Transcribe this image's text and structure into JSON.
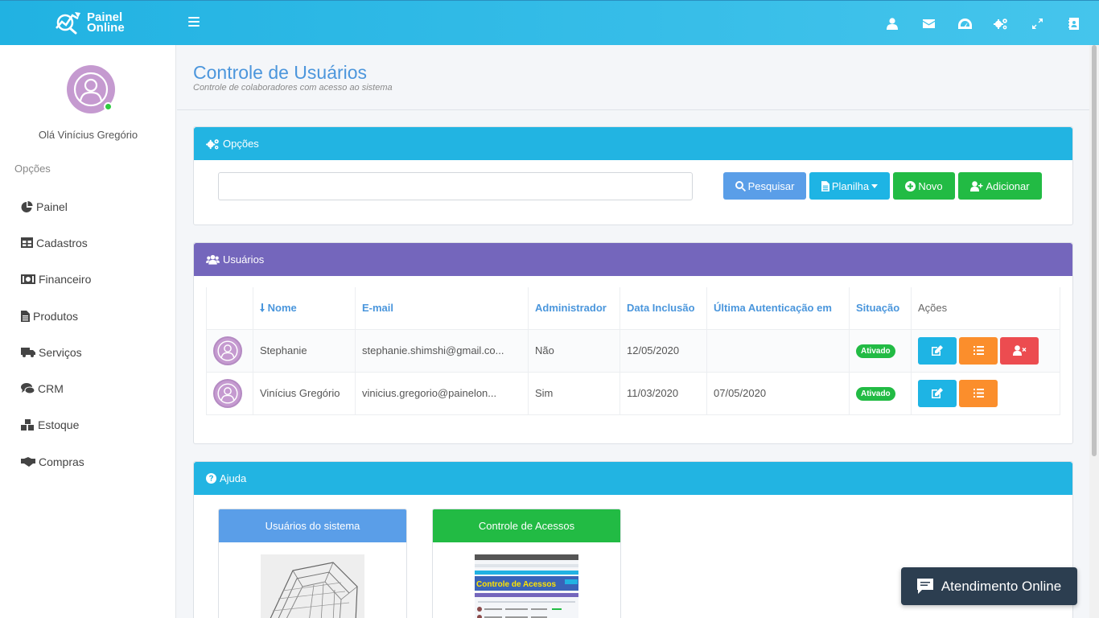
{
  "brand": {
    "line1": "Painel",
    "line2": "Online"
  },
  "topbar": {
    "icons": [
      "user-icon",
      "envelope-icon",
      "dashboard-icon",
      "cogs-icon",
      "expand-icon",
      "address-book-icon"
    ]
  },
  "sidebar": {
    "greeting": "Olá Vinícius Gregório",
    "section_title": "Opções",
    "items": [
      {
        "label": "Painel",
        "icon": "pie-chart-icon"
      },
      {
        "label": "Cadastros",
        "icon": "table-icon"
      },
      {
        "label": "Financeiro",
        "icon": "money-icon"
      },
      {
        "label": "Produtos",
        "icon": "file-icon"
      },
      {
        "label": "Serviços",
        "icon": "truck-icon"
      },
      {
        "label": "CRM",
        "icon": "comments-icon"
      },
      {
        "label": "Estoque",
        "icon": "cubes-icon"
      },
      {
        "label": "Compras",
        "icon": "handshake-icon"
      }
    ]
  },
  "page": {
    "title": "Controle de Usuários",
    "subtitle": "Controle de colaboradores com acesso ao sistema"
  },
  "options_box": {
    "title": "Opções",
    "search_value": "",
    "buttons": {
      "search": "Pesquisar",
      "sheet": "Planilha",
      "new": "Novo",
      "add": "Adicionar"
    }
  },
  "users_box": {
    "title": "Usuários",
    "columns": [
      "Nome",
      "E-mail",
      "Administrador",
      "Data Inclusão",
      "Última Autenticação em",
      "Situação",
      "Ações"
    ],
    "rows": [
      {
        "name": "Stephanie",
        "email": "stephanie.shimshi@gmail.co...",
        "admin": "Não",
        "created": "12/05/2020",
        "last_auth": "",
        "status": "Ativado"
      },
      {
        "name": "Vinícius Gregório",
        "email": "vinicius.gregorio@painelon...",
        "admin": "Sim",
        "created": "11/03/2020",
        "last_auth": "07/05/2020",
        "status": "Ativado"
      }
    ]
  },
  "help_box": {
    "title": "Ajuda",
    "cards": [
      {
        "title": "Usuários do sistema",
        "color": "#5a9ee8"
      },
      {
        "title": "Controle de Acessos",
        "color": "#22bb44",
        "thumb_text": "Controle de Acessos"
      }
    ]
  },
  "chat": {
    "label": "Atendimento Online"
  },
  "colors": {
    "topbar": "#21b2e2",
    "title": "#4c96dc",
    "purple": "#7466bc",
    "green": "#22bb44",
    "orange": "#fb8e2c",
    "red": "#ec4c50",
    "chat": "#2c3e50"
  }
}
